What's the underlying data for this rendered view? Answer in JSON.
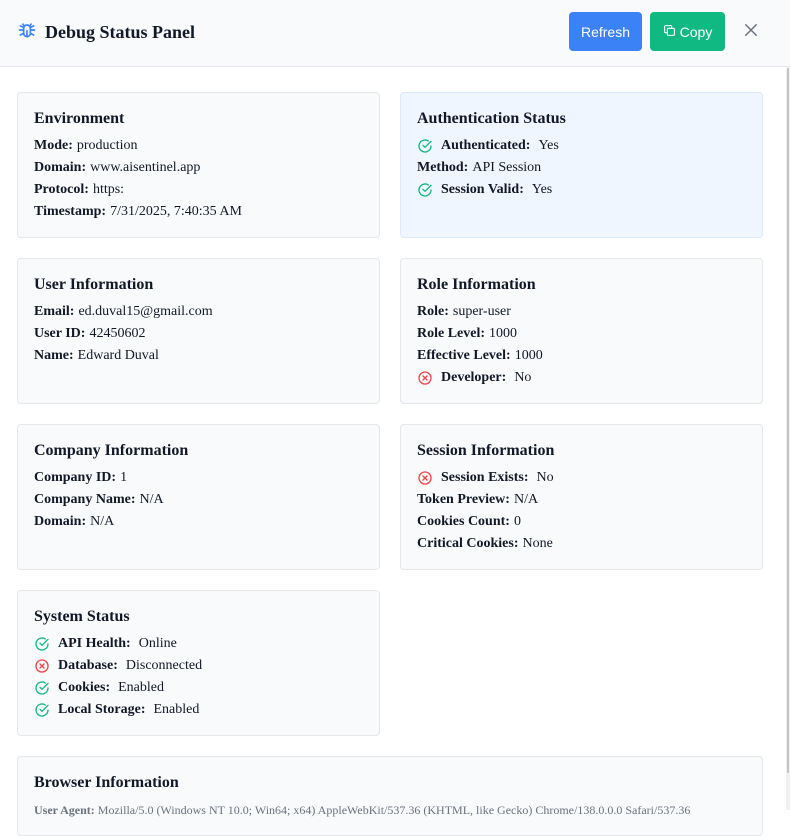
{
  "header": {
    "title": "Debug Status Panel",
    "refresh_label": "Refresh",
    "copy_label": "Copy",
    "icon": "bug-icon",
    "colors": {
      "refresh": "#3b82f6",
      "copy": "#10b981",
      "icon": "#3b82f6"
    }
  },
  "environment": {
    "title": "Environment",
    "mode_label": "Mode:",
    "mode": "production",
    "domain_label": "Domain:",
    "domain": "www.aisentinel.app",
    "protocol_label": "Protocol:",
    "protocol": "https:",
    "timestamp_label": "Timestamp:",
    "timestamp": "7/31/2025, 7:40:35 AM"
  },
  "auth": {
    "title": "Authentication Status",
    "authenticated_label": "Authenticated:",
    "authenticated": "Yes",
    "method_label": "Method:",
    "method": "API Session",
    "session_valid_label": "Session Valid:",
    "session_valid": "Yes"
  },
  "user": {
    "title": "User Information",
    "email_label": "Email:",
    "email": "ed.duval15@gmail.com",
    "user_id_label": "User ID:",
    "user_id": "42450602",
    "name_label": "Name:",
    "name": "Edward Duval"
  },
  "role": {
    "title": "Role Information",
    "role_label": "Role:",
    "role": "super-user",
    "role_level_label": "Role Level:",
    "role_level": "1000",
    "effective_level_label": "Effective Level:",
    "effective_level": "1000",
    "developer_label": "Developer:",
    "developer": "No"
  },
  "company": {
    "title": "Company Information",
    "company_id_label": "Company ID:",
    "company_id": "1",
    "company_name_label": "Company Name:",
    "company_name": "N/A",
    "domain_label": "Domain:",
    "domain": "N/A"
  },
  "session": {
    "title": "Session Information",
    "exists_label": "Session Exists:",
    "exists": "No",
    "token_label": "Token Preview:",
    "token": "N/A",
    "cookies_count_label": "Cookies Count:",
    "cookies_count": "0",
    "critical_label": "Critical Cookies:",
    "critical": "None"
  },
  "system": {
    "title": "System Status",
    "api_label": "API Health:",
    "api": "Online",
    "db_label": "Database:",
    "db": "Disconnected",
    "cookies_label": "Cookies:",
    "cookies": "Enabled",
    "storage_label": "Local Storage:",
    "storage": "Enabled"
  },
  "browser": {
    "title": "Browser Information",
    "ua_label": "User Agent:",
    "ua": "Mozilla/5.0 (Windows NT 10.0; Win64; x64) AppleWebKit/537.36 (KHTML, like Gecko) Chrome/138.0.0.0 Safari/537.36"
  },
  "status_colors": {
    "ok": "#10b981",
    "error": "#ef4444"
  }
}
